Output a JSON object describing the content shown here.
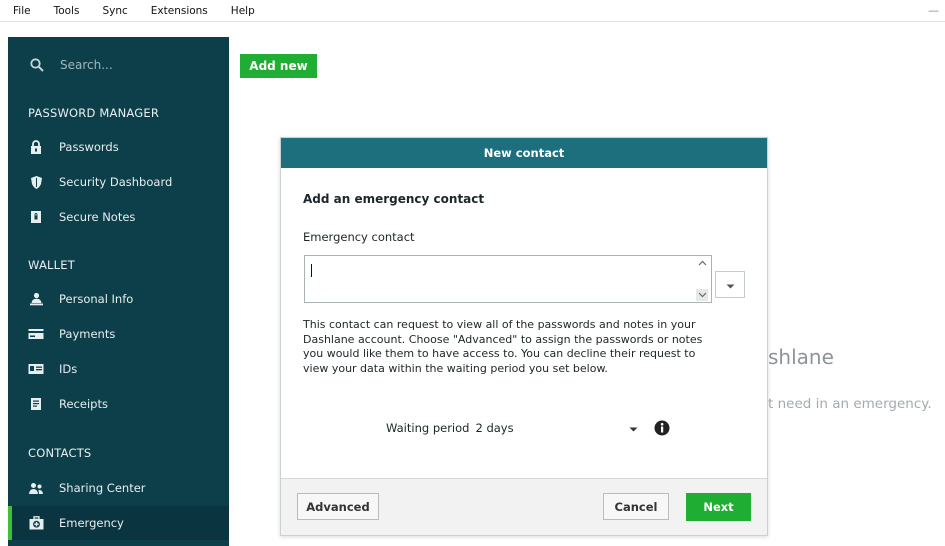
{
  "menubar": {
    "items": [
      "File",
      "Tools",
      "Sync",
      "Extensions",
      "Help"
    ],
    "minimize": "—"
  },
  "sidebar": {
    "search_placeholder": "Search...",
    "sections": {
      "password_manager": "PASSWORD MANAGER",
      "wallet": "WALLET",
      "contacts": "CONTACTS"
    },
    "items": {
      "passwords": "Passwords",
      "security_dashboard": "Security Dashboard",
      "secure_notes": "Secure Notes",
      "personal_info": "Personal Info",
      "payments": "Payments",
      "ids": "IDs",
      "receipts": "Receipts",
      "sharing_center": "Sharing Center",
      "emergency": "Emergency"
    },
    "active_item": "Emergency"
  },
  "main": {
    "add_new_label": "Add new",
    "background_title": "shlane",
    "background_subtitle": "t need in an emergency."
  },
  "modal": {
    "title": "New contact",
    "heading": "Add an emergency contact",
    "field_label": "Emergency contact",
    "field_value": "",
    "description": "This contact can request to view all of the passwords and notes in your Dashlane account. Choose \"Advanced\" to assign the passwords or notes you would like them to have access to. You can decline their request to view your data within the waiting period you set below.",
    "waiting_period_label": "Waiting period",
    "waiting_period_value": "2 days",
    "buttons": {
      "advanced": "Advanced",
      "cancel": "Cancel",
      "next": "Next"
    }
  },
  "colors": {
    "sidebar_bg": "#0d3f4b",
    "modal_header": "#1d6f7e",
    "accent_green": "#1fad33"
  }
}
